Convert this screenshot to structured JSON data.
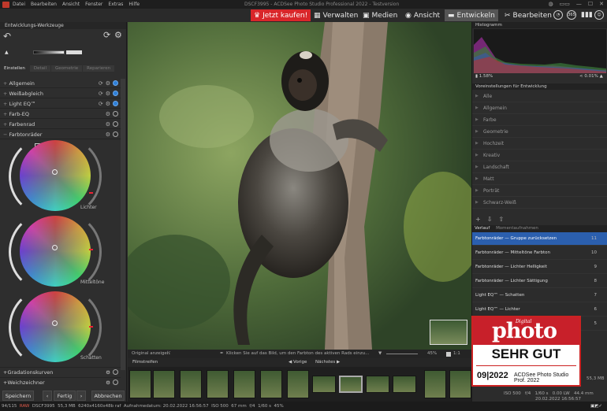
{
  "menubar": {
    "items": [
      "Datei",
      "Bearbeiten",
      "Ansicht",
      "Fenster",
      "Extras",
      "Hilfe"
    ],
    "title": "DSCF3995 - ACDSee Photo Studio Professional 2022 - Testversion"
  },
  "modebar": {
    "buy": "Jetzt kaufen!",
    "tabs": [
      "Verwalten",
      "Medien",
      "Ansicht",
      "Entwickeln",
      "Bearbeiten"
    ],
    "active_tab": "Entwickeln",
    "circle_label": "365"
  },
  "left": {
    "panel_title": "Entwicklungs-Werkzeuge",
    "tabs": [
      "Einstellen",
      "Detail",
      "Geometrie",
      "Reparieren"
    ],
    "sections": [
      "Allgemein",
      "Weißabgleich",
      "Light EQ™",
      "Farb-EQ",
      "Farbenrad",
      "Farbtonräder"
    ],
    "wheels": [
      "Lichter",
      "Mitteltöne",
      "Schatten"
    ],
    "bottom_sections": [
      "Gradationskurven",
      "Weichzeichner"
    ],
    "buttons": {
      "save": "Speichern",
      "done": "Fertig",
      "cancel": "Abbrechen"
    }
  },
  "center": {
    "original_label": "Original anzeigen",
    "hint": "Klicken Sie auf das Bild, um den Farbton des aktiven Rads einzu...",
    "zoom": "45%",
    "zoom_ratio": "1:1",
    "filmstrip_label": "Filmstreifen",
    "prev": "Vorige",
    "next": "Nächstes"
  },
  "right": {
    "histogram_title": "Histogramm",
    "hist_left": "1.58%",
    "hist_right": "< 0.01%",
    "presets_title": "Voreinstellungen für Entwicklung",
    "presets": [
      "Alle",
      "Allgemein",
      "Farbe",
      "Geometrie",
      "Hochzeit",
      "Kreativ",
      "Landschaft",
      "Matt",
      "Porträt",
      "Schwarz-Weiß"
    ],
    "history_tabs": [
      "Verlauf",
      "Momentaufnahmen"
    ],
    "history": [
      {
        "label": "Farbtonräder — Gruppe zurücksetzen",
        "num": "11"
      },
      {
        "label": "Farbtonräder — Mitteltöne Farbton",
        "num": "10"
      },
      {
        "label": "Farbtonräder — Lichter Helligkeit",
        "num": "9"
      },
      {
        "label": "Farbtonräder — Lichter Sättigung",
        "num": "8"
      },
      {
        "label": "Light EQ™ — Schatten",
        "num": "7"
      },
      {
        "label": "Light EQ™ — Lichter",
        "num": "6"
      },
      {
        "label": "",
        "num": "5"
      }
    ],
    "exif": {
      "iso": "ISO 500",
      "fstop": "f/4",
      "shutter": "1/60 s",
      "ev": "0.00 LW",
      "focal": "44.4 mm",
      "size": "55,3 MB",
      "date": "20.02.2022 16:56:57"
    }
  },
  "award": {
    "brand_small": "Digital",
    "brand": "photo",
    "grade": "SEHR GUT",
    "issue": "09|2022",
    "product": "ACDSee Photo Studio Prof. 2022"
  },
  "status": {
    "count": "94/115",
    "raw": "RAW",
    "file": "DSCF3995",
    "filesize": "55,3 MB",
    "dims": "6240x4160x48b raf",
    "taken": "Aufnahmedatum: 20.02.2022 16:56:57",
    "iso": "ISO 500",
    "focal": "67 mm",
    "fstop": "f/4",
    "shutter": "1/60 s",
    "zoom": "45%"
  }
}
